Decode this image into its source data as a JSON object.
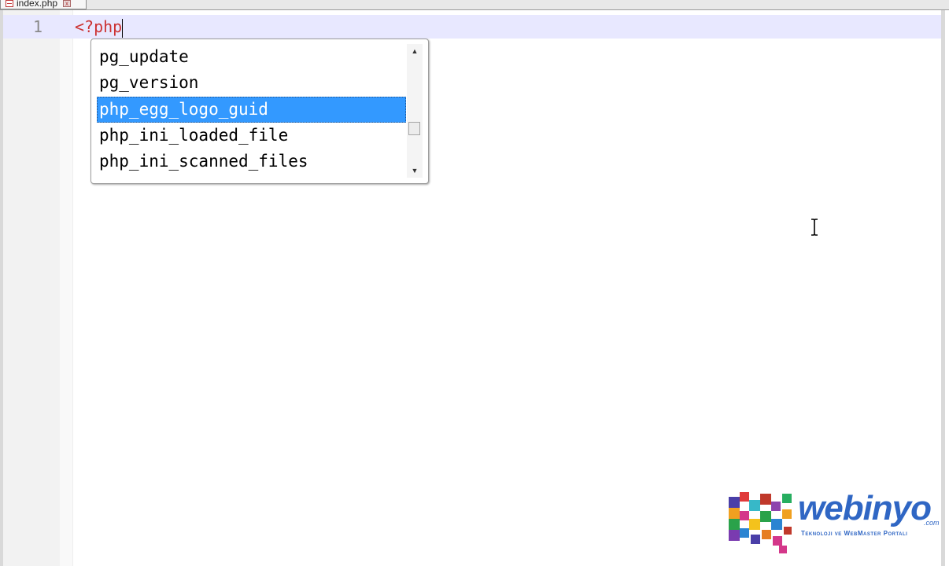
{
  "tab": {
    "label": "index.php",
    "close_icon": "close-icon",
    "file_icon": "php-file-icon"
  },
  "editor": {
    "line_number": "1",
    "code": "<?php"
  },
  "autocomplete": {
    "items": [
      {
        "label": "pg_update",
        "selected": false
      },
      {
        "label": "pg_version",
        "selected": false
      },
      {
        "label": "php_egg_logo_guid",
        "selected": true
      },
      {
        "label": "php_ini_loaded_file",
        "selected": false
      },
      {
        "label": "php_ini_scanned_files",
        "selected": false
      }
    ],
    "scroll_up_icon": "scroll-up-arrow-icon",
    "scroll_down_icon": "scroll-down-arrow-icon",
    "selection_color": "#3399ff"
  },
  "logo": {
    "wordmark": "webinyo",
    "tld": ".com",
    "tagline": "Teknoloji ve WebMaster Portalı",
    "brand_color": "#2f66c4"
  },
  "colors": {
    "current_line": "#e8e8ff",
    "php_tag": "#cc3333",
    "gutter": "#f2f2f2"
  }
}
